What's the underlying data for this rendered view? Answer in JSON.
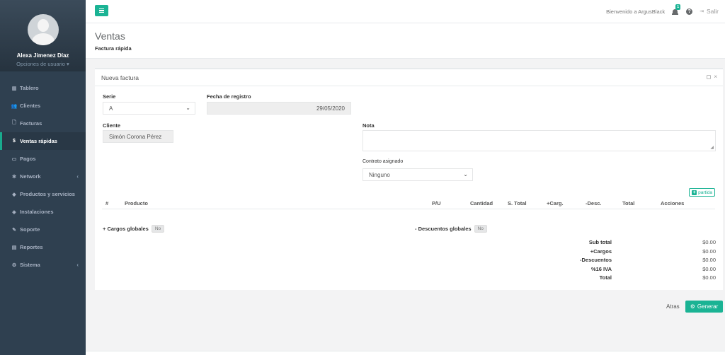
{
  "user": {
    "name": "Alexa Jimenez Díaz",
    "options_label": "Opciones de usuario ▾"
  },
  "sidebar": {
    "items": [
      {
        "icon": "▥",
        "label": "Tablero"
      },
      {
        "icon": "👥",
        "label": "Clientes"
      },
      {
        "icon": "🗋",
        "label": "Facturas"
      },
      {
        "icon": "$",
        "label": "Ventas rápidas"
      },
      {
        "icon": "▭",
        "label": "Pagos"
      },
      {
        "icon": "✻",
        "label": "Network"
      },
      {
        "icon": "◆",
        "label": "Productos y servicios"
      },
      {
        "icon": "◈",
        "label": "Instalaciones"
      },
      {
        "icon": "✎",
        "label": "Soporte"
      },
      {
        "icon": "▤",
        "label": "Reportes"
      },
      {
        "icon": "⚙",
        "label": "Sistema"
      }
    ],
    "active_index": 3
  },
  "topbar": {
    "welcome": "Bienvenido a ArgusBlack",
    "notification_count": "1",
    "help_glyph": "?",
    "exit_label": "Salir"
  },
  "page": {
    "title": "Ventas",
    "subtitle": "Factura rápida"
  },
  "card": {
    "title": "Nueva factura",
    "serie": {
      "label": "Serie",
      "value": "A"
    },
    "fecha": {
      "label": "Fecha de registro",
      "value": "29/05/2020"
    },
    "cliente": {
      "label": "Cliente",
      "value": "Simón Corona Pérez"
    },
    "nota": {
      "label": "Nota",
      "value": ""
    },
    "contrato": {
      "label": "Contrato asignado",
      "value": "Ninguno"
    },
    "add_partida": "partida",
    "table_headers": [
      "#",
      "Producto",
      "P/U",
      "Cantidad",
      "S. Total",
      "+Carg.",
      "-Desc.",
      "Total",
      "Acciones"
    ],
    "cargos_globales": {
      "label": "+ Cargos globales",
      "toggle": "No"
    },
    "descuentos_globales": {
      "label": "- Descuentos globales",
      "toggle": "No"
    },
    "totals": [
      {
        "label": "Sub total",
        "value": "$0.00"
      },
      {
        "label": "+Cargos",
        "value": "$0.00"
      },
      {
        "label": "-Descuentos",
        "value": "$0.00"
      },
      {
        "label": "%16 IVA",
        "value": "$0.00"
      },
      {
        "label": "Total",
        "value": "$0.00"
      }
    ]
  },
  "actions": {
    "back": "Atras",
    "generate": "Generar"
  },
  "colors": {
    "accent": "#1ab394",
    "sidebar": "#2f4050"
  }
}
